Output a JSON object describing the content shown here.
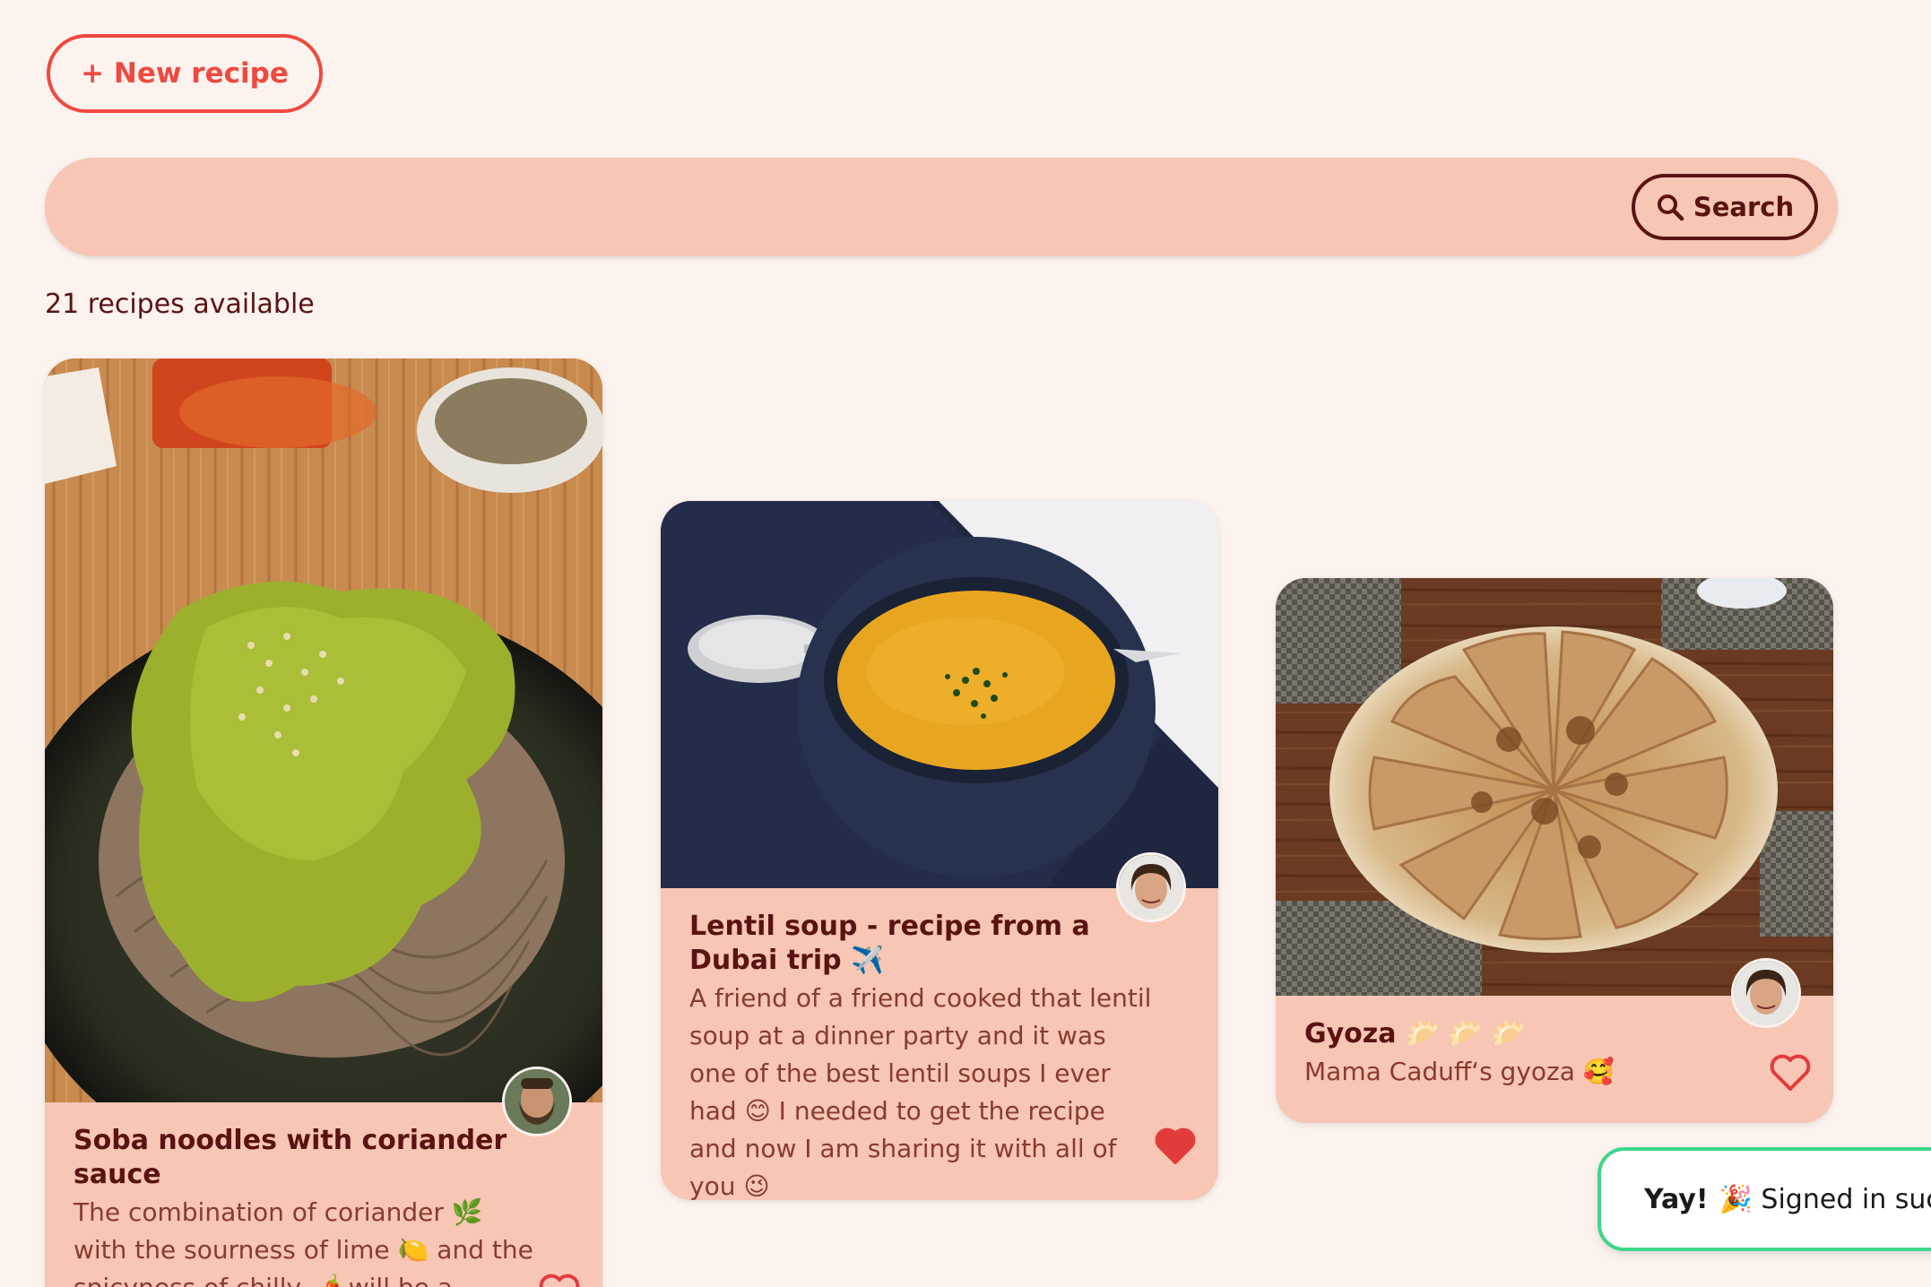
{
  "toolbar": {
    "new_recipe_label": "+ New recipe"
  },
  "search": {
    "placeholder": "",
    "value": "",
    "button_label": "Search"
  },
  "recipe_count_text": "21 recipes available",
  "recipes": [
    {
      "title": "Soba noodles with coriander sauce",
      "description": "The combination of coriander 🌿 with the sourness of lime 🍋 and the spicyness of chilly 🌶️ will be a",
      "liked": false
    },
    {
      "title": "Lentil soup - recipe from a Dubai trip ✈️",
      "description": "A friend of a friend cooked that lentil soup at a dinner party and it was one of the best lentil soups I ever had 😊 I needed to get the recipe and now I am sharing it with all of you 😉",
      "liked": true
    },
    {
      "title": "Gyoza 🥟 🥟 🥟",
      "description": "Mama Caduff‘s gyoza 🥰",
      "liked": false
    }
  ],
  "toast": {
    "emphasis": "Yay!",
    "message": "🎉 Signed in successfully"
  },
  "colors": {
    "background": "#fcf3ee",
    "card": "#f7c6b4",
    "accent": "#ef4a3f",
    "text": "#5a1212",
    "heart": "#e23b3b",
    "toast_border": "#3ed68a"
  },
  "icons": {
    "search": "search-icon",
    "heart_outline": "heart-outline-icon",
    "heart_filled": "heart-filled-icon",
    "avatar": "avatar"
  }
}
